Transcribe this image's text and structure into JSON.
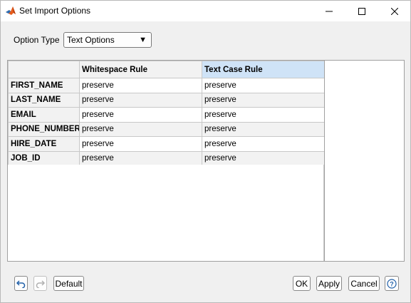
{
  "window": {
    "title": "Set Import Options"
  },
  "options": {
    "label": "Option Type",
    "selected": "Text Options"
  },
  "table": {
    "columns": [
      "Whitespace Rule",
      "Text Case Rule"
    ],
    "rows": [
      {
        "name": "FIRST_NAME",
        "cells": [
          "preserve",
          "preserve"
        ]
      },
      {
        "name": "LAST_NAME",
        "cells": [
          "preserve",
          "preserve"
        ]
      },
      {
        "name": "EMAIL",
        "cells": [
          "preserve",
          "preserve"
        ]
      },
      {
        "name": "PHONE_NUMBER",
        "cells": [
          "preserve",
          "preserve"
        ]
      },
      {
        "name": "HIRE_DATE",
        "cells": [
          "preserve",
          "preserve"
        ]
      },
      {
        "name": "JOB_ID",
        "cells": [
          "preserve",
          "preserve"
        ]
      }
    ]
  },
  "buttons": {
    "default": "Default",
    "ok": "OK",
    "apply": "Apply",
    "cancel": "Cancel",
    "help": "?"
  },
  "colors": {
    "selected_header": "#cfe3f7",
    "matlab_icon": "#e65c1c"
  }
}
